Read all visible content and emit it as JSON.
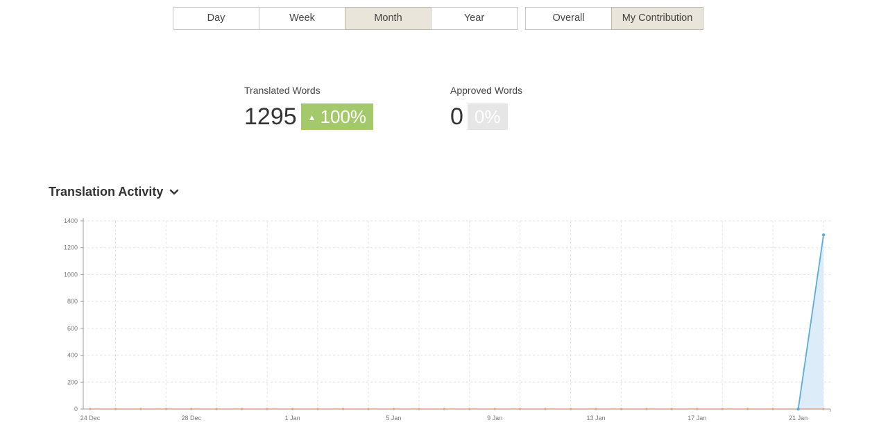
{
  "period_buttons": [
    {
      "label": "Day",
      "active": false
    },
    {
      "label": "Week",
      "active": false
    },
    {
      "label": "Month",
      "active": true
    },
    {
      "label": "Year",
      "active": false
    }
  ],
  "scope_buttons": [
    {
      "label": "Overall",
      "active": false
    },
    {
      "label": "My Contribution",
      "active": true
    }
  ],
  "metrics": {
    "translated": {
      "label": "Translated Words",
      "value": "1295",
      "change": "100%",
      "arrow": "▲"
    },
    "approved": {
      "label": "Approved Words",
      "value": "0",
      "change": "0%"
    }
  },
  "section_title": "Translation Activity",
  "colors": {
    "line": "#5aabde",
    "area": "#dcecf8",
    "flat_line": "#e0a08c",
    "grid": "#e3e3e3",
    "badge_up": "#a3c96b",
    "badge_zero": "#e6e6e6",
    "active_button": "#e9e5da"
  },
  "chart_data": {
    "type": "area",
    "title": "",
    "xlabel": "",
    "ylabel": "",
    "ylim": [
      0,
      1400
    ],
    "yticks": [
      0,
      200,
      400,
      600,
      800,
      1000,
      1200,
      1400
    ],
    "x_start": "24 Dec",
    "x_tick_labels": [
      {
        "day": 0,
        "label": "24 Dec"
      },
      {
        "day": 4,
        "label": "28 Dec"
      },
      {
        "day": 8,
        "label": "1 Jan"
      },
      {
        "day": 12,
        "label": "5 Jan"
      },
      {
        "day": 16,
        "label": "9 Jan"
      },
      {
        "day": 20,
        "label": "13 Jan"
      },
      {
        "day": 24,
        "label": "17 Jan"
      },
      {
        "day": 28,
        "label": "21 Jan"
      }
    ],
    "grid": true,
    "series": [
      {
        "type": "area",
        "x": [
          "21 Jan",
          "22 Jan"
        ],
        "values": [
          0,
          1295
        ]
      },
      {
        "type": "line",
        "x": [
          "24 Dec",
          "25 Dec",
          "26 Dec",
          "27 Dec",
          "28 Dec",
          "29 Dec",
          "30 Dec",
          "31 Dec",
          "1 Jan",
          "2 Jan",
          "3 Jan",
          "4 Jan",
          "5 Jan",
          "6 Jan",
          "7 Jan",
          "8 Jan",
          "9 Jan",
          "10 Jan",
          "11 Jan",
          "12 Jan",
          "13 Jan",
          "14 Jan",
          "15 Jan",
          "16 Jan",
          "17 Jan",
          "18 Jan",
          "19 Jan",
          "20 Jan",
          "21 Jan",
          "22 Jan"
        ],
        "values": [
          0,
          0,
          0,
          0,
          0,
          0,
          0,
          0,
          0,
          0,
          0,
          0,
          0,
          0,
          0,
          0,
          0,
          0,
          0,
          0,
          0,
          0,
          0,
          0,
          0,
          0,
          0,
          0,
          0,
          0
        ]
      }
    ]
  }
}
